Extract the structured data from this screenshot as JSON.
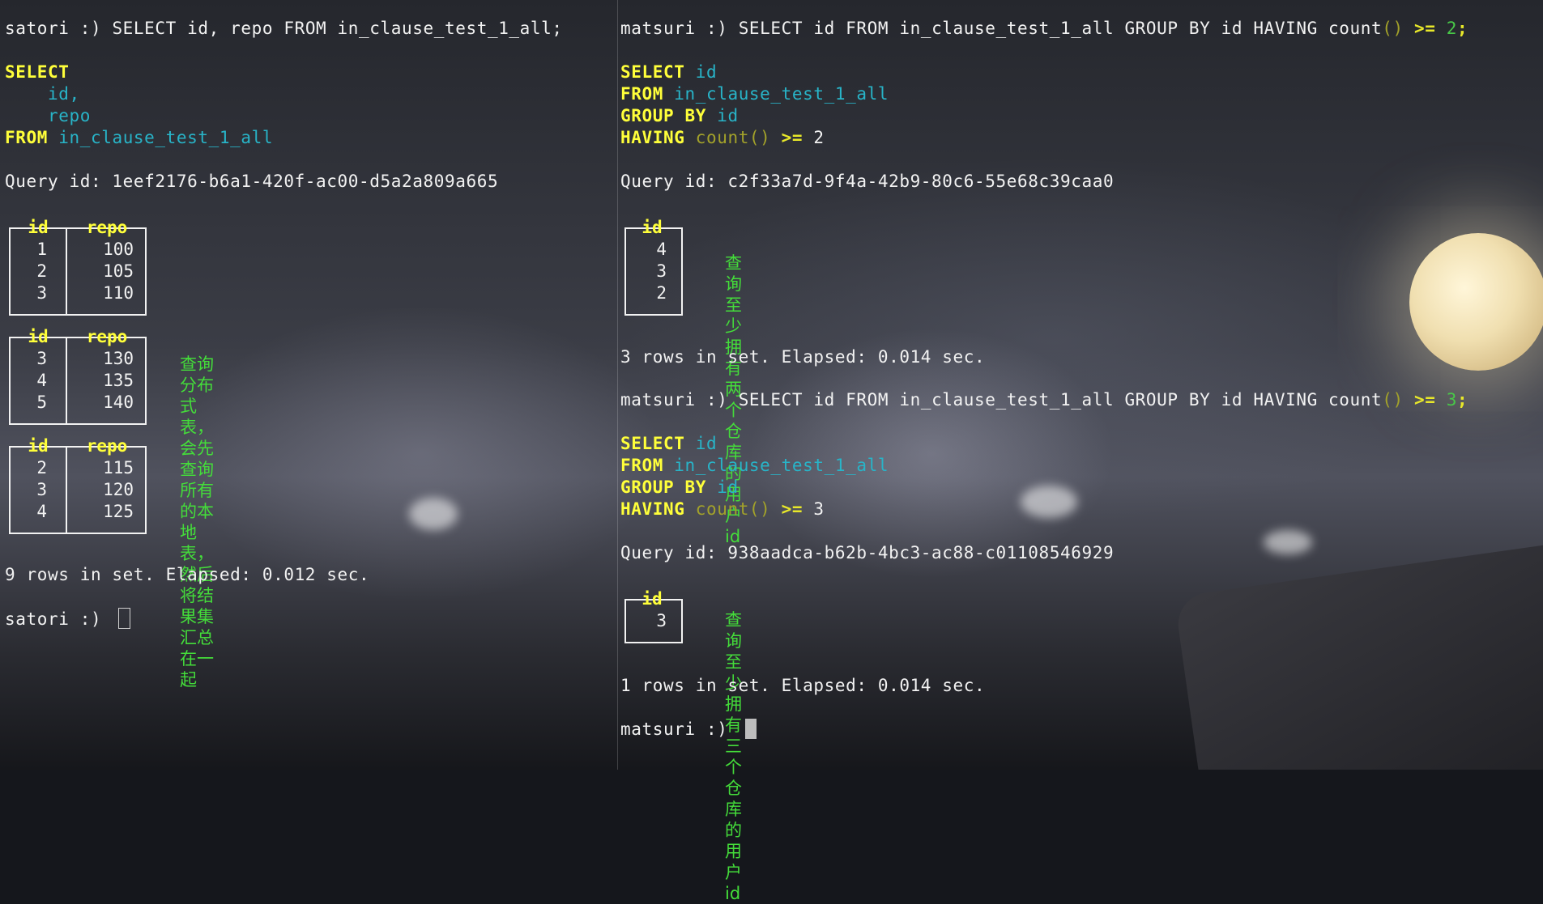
{
  "left": {
    "prompt": "satori :) ",
    "command": "SELECT id, repo FROM in_clause_test_1_all;",
    "formatted": {
      "select_kw": "SELECT",
      "col1": "id,",
      "col2": "repo",
      "from_kw": "FROM",
      "table": "in_clause_test_1_all"
    },
    "query_id": "Query id: 1eef2176-b6a1-420f-ac00-d5a2a809a665",
    "result_blocks": [
      {
        "headers": [
          "id",
          "repo"
        ],
        "rows": [
          [
            "1",
            "100"
          ],
          [
            "2",
            "105"
          ],
          [
            "3",
            "110"
          ]
        ]
      },
      {
        "headers": [
          "id",
          "repo"
        ],
        "rows": [
          [
            "3",
            "130"
          ],
          [
            "4",
            "135"
          ],
          [
            "5",
            "140"
          ]
        ]
      },
      {
        "headers": [
          "id",
          "repo"
        ],
        "rows": [
          [
            "2",
            "115"
          ],
          [
            "3",
            "120"
          ],
          [
            "4",
            "125"
          ]
        ]
      }
    ],
    "note_line1": "查询分布式表，会先查询所有的本地表，",
    "note_line2": "然后将结果集汇总在一起",
    "summary": "9 rows in set. Elapsed: 0.012 sec.",
    "final_prompt": "satori :) "
  },
  "right": {
    "q1": {
      "prompt": "matsuri :) ",
      "command_pre": "SELECT id FROM in_clause_test_1_all GROUP BY id HAVING count",
      "command_parens": "()",
      "command_op": " >= ",
      "command_num": "2",
      "command_end": ";",
      "formatted": {
        "select_kw": "SELECT",
        "select_col": "id",
        "from_kw": "FROM",
        "table": "in_clause_test_1_all",
        "group_kw": "GROUP BY",
        "group_col": "id",
        "having_kw": "HAVING",
        "having_fn": "count()",
        "having_op": ">=",
        "having_val": "2"
      },
      "query_id": "Query id: c2f33a7d-9f4a-42b9-80c6-55e68c39caa0",
      "result": {
        "header": "id",
        "rows": [
          "4",
          "3",
          "2"
        ]
      },
      "note": "查询至少拥有两个仓库的用户 id",
      "summary": "3 rows in set. Elapsed: 0.014 sec."
    },
    "q2": {
      "prompt": "matsuri :) ",
      "command_pre": "SELECT id FROM in_clause_test_1_all GROUP BY id HAVING count",
      "command_parens": "()",
      "command_op": " >= ",
      "command_num": "3",
      "command_end": ";",
      "formatted": {
        "select_kw": "SELECT",
        "select_col": "id",
        "from_kw": "FROM",
        "table": "in_clause_test_1_all",
        "group_kw": "GROUP BY",
        "group_col": "id",
        "having_kw": "HAVING",
        "having_fn": "count()",
        "having_op": ">=",
        "having_val": "3"
      },
      "query_id": "Query id: 938aadca-b62b-4bc3-ac88-c01108546929",
      "result": {
        "header": "id",
        "rows": [
          "3"
        ]
      },
      "note": "查询至少拥有三个仓库的用户 id",
      "summary": "1 rows in set. Elapsed: 0.014 sec."
    },
    "final_prompt": "matsuri :) "
  },
  "colors": {
    "keyword": "#ffff3a",
    "identifier": "#28b4c8",
    "function": "#a3a22a",
    "annotation": "#44dd3a",
    "text": "#f2f2f2"
  }
}
